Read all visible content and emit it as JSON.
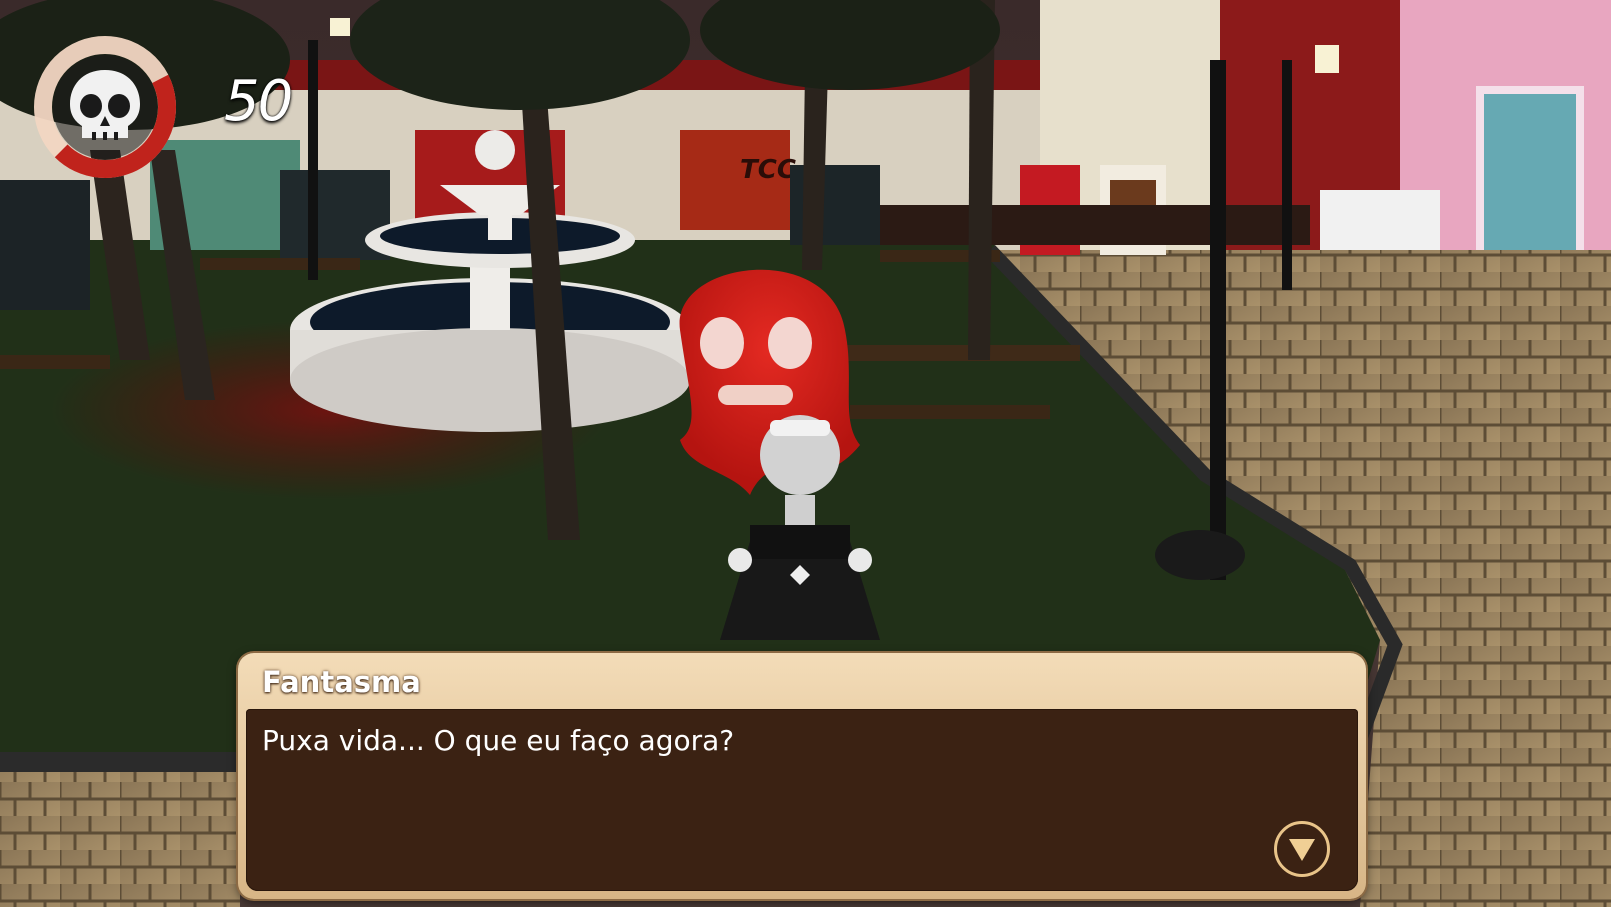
{
  "hud": {
    "score": "50",
    "icon": "skull-icon",
    "ring_color": "#c0231c",
    "ring_fill_fraction": 0.45
  },
  "dialog": {
    "speaker": "Fantasma",
    "text": "Puxa vida... O que eu faço agora?",
    "advance_icon": "triangle-down-icon"
  },
  "scene": {
    "signs": [
      "TCC"
    ],
    "colors": {
      "ghost": "#d91a17",
      "dialog_frame": "#e8c89a",
      "dialog_body": "#3b2213",
      "grass": "#233019",
      "pavement": "#9b8560"
    }
  }
}
